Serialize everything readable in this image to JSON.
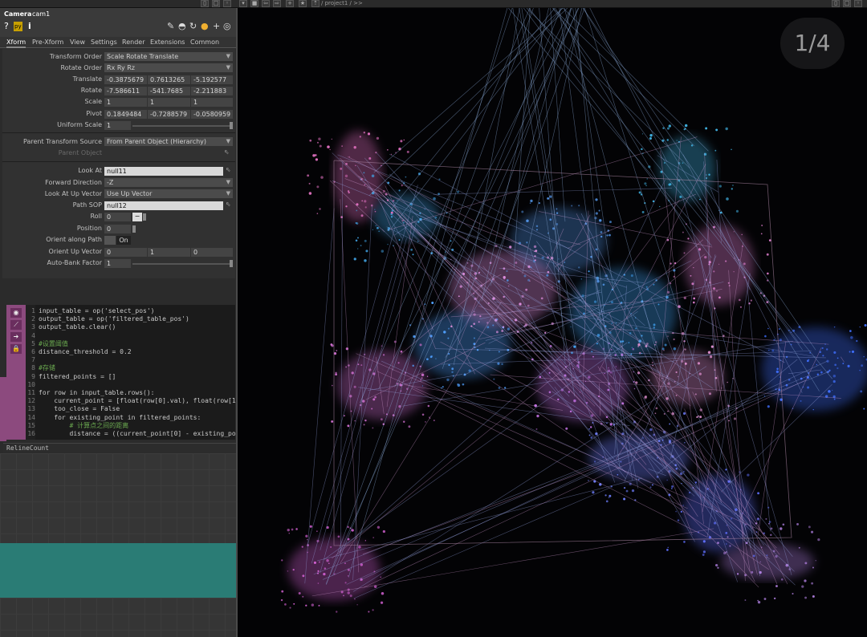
{
  "topbar": {
    "path": "/ project1 / >>"
  },
  "header": {
    "op_type": "Camera",
    "op_name": "cam1",
    "help_icon": "?",
    "python_icon": "py",
    "info_icon": "i"
  },
  "tabs": [
    "Xform",
    "Pre-Xform",
    "View",
    "Settings",
    "Render",
    "Extensions",
    "Common"
  ],
  "params": {
    "transform_order": {
      "label": "Transform Order",
      "value": "Scale Rotate Translate"
    },
    "rotate_order": {
      "label": "Rotate Order",
      "value": "Rx Ry Rz"
    },
    "translate": {
      "label": "Translate",
      "values": [
        "-0.3875679",
        "0.7613265",
        "-5.192577"
      ]
    },
    "rotate": {
      "label": "Rotate",
      "values": [
        "-7.586611",
        "-541.7685",
        "-2.211883"
      ]
    },
    "scale": {
      "label": "Scale",
      "values": [
        "1",
        "1",
        "1"
      ]
    },
    "pivot": {
      "label": "Pivot",
      "values": [
        "0.1849484",
        "-0.7288579",
        "-0.0580959"
      ]
    },
    "uniform_scale": {
      "label": "Uniform Scale",
      "value": "1"
    },
    "parent_transform_source": {
      "label": "Parent Transform Source",
      "value": "From Parent Object (Hierarchy)"
    },
    "parent_object": {
      "label": "Parent Object"
    },
    "look_at": {
      "label": "Look At",
      "value": "null11"
    },
    "forward_direction": {
      "label": "Forward Direction",
      "value": "-Z"
    },
    "look_at_up_vector": {
      "label": "Look At Up Vector",
      "value": "Use Up Vector"
    },
    "path_sop": {
      "label": "Path SOP",
      "value": "null12"
    },
    "roll": {
      "label": "Roll",
      "value": "0"
    },
    "position": {
      "label": "Position",
      "value": "0"
    },
    "orient_along_path": {
      "label": "Orient along Path",
      "value": "On"
    },
    "orient_up_vector": {
      "label": "Orient Up Vector",
      "values": [
        "0",
        "1",
        "0"
      ]
    },
    "auto_bank_factor": {
      "label": "Auto-Bank Factor",
      "value": "1"
    }
  },
  "code": {
    "lines": [
      {
        "n": "1",
        "text": "input_table = op('select_pos')"
      },
      {
        "n": "2",
        "text": "output_table = op('filtered_table_pos')"
      },
      {
        "n": "3",
        "text": "output_table.clear()"
      },
      {
        "n": "4",
        "text": ""
      },
      {
        "n": "5",
        "text": "#设置阈值",
        "comment": true
      },
      {
        "n": "6",
        "text": "distance_threshold = 0.2"
      },
      {
        "n": "7",
        "text": ""
      },
      {
        "n": "8",
        "text": "#存储",
        "comment": true
      },
      {
        "n": "9",
        "text": "filtered_points = []"
      },
      {
        "n": "10",
        "text": ""
      },
      {
        "n": "11",
        "text": "for row in input_table.rows():"
      },
      {
        "n": "12",
        "text": "    current_point = [float(row[0].val), float(row[1]"
      },
      {
        "n": "13",
        "text": "    too_close = False"
      },
      {
        "n": "14",
        "text": "    for existing_point in filtered_points:"
      },
      {
        "n": "15",
        "text": "        # 计算点之间的距离",
        "comment": true
      },
      {
        "n": "16",
        "text": "        distance = ((current_point[0] - existing_poi"
      }
    ],
    "dat_title": "RelineCount"
  },
  "viewport": {
    "page_indicator": "1/4"
  },
  "colors": {
    "accent_pink": "#8c4a7e",
    "teal": "#2a7c75"
  }
}
